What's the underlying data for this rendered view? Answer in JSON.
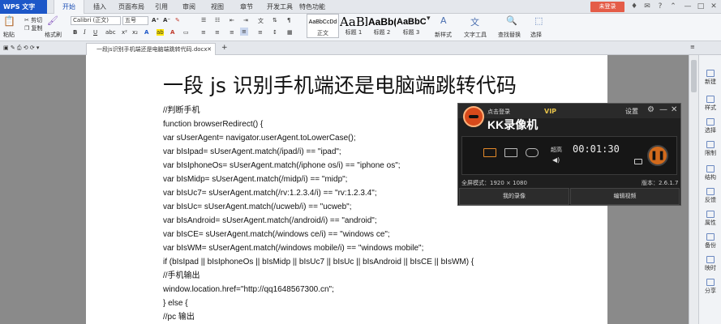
{
  "app": {
    "logo": "WPS 文字",
    "login": "未登录"
  },
  "menu_tabs": [
    "开始",
    "插入",
    "页面布局",
    "引用",
    "审阅",
    "视图",
    "章节",
    "开发工具",
    "特色功能"
  ],
  "ribbon": {
    "paste": "粘贴",
    "cut": "剪切",
    "copy": "复制",
    "format_painter": "格式刷",
    "font_name": "Calibri (正文)",
    "font_size": "五号",
    "styles": [
      {
        "preview": "AaBbCcDd",
        "label": "正文"
      },
      {
        "preview": "AaBl",
        "label": "标题 1"
      },
      {
        "preview": "AaBb(",
        "label": "标题 2"
      },
      {
        "preview": "AaBbC",
        "label": "标题 3"
      }
    ],
    "new_style": "新样式",
    "text_tool": "文字工具",
    "find_replace": "查找替换",
    "select": "选择"
  },
  "doc_tab": "一段js识别手机端还是电脑端跳转代码.docx",
  "sidebar": [
    "新建",
    "样式",
    "选择",
    "限制",
    "结构",
    "反馈",
    "属性",
    "备份",
    "映时",
    "分享"
  ],
  "document": {
    "heading": "一段 js 识别手机端还是电脑端跳转代码",
    "lines": [
      "//判断手机",
      "function browserRedirect() {",
      "var sUserAgent= navigator.userAgent.toLowerCase();",
      "var bIsIpad= sUserAgent.match(/ipad/i) == \"ipad\";",
      "var bIsIphoneOs= sUserAgent.match(/iphone os/i) == \"iphone os\";",
      "var bIsMidp= sUserAgent.match(/midp/i) == \"midp\";",
      "var bIsUc7= sUserAgent.match(/rv:1.2.3.4/i) == \"rv:1.2.3.4\";",
      "var bIsUc= sUserAgent.match(/ucweb/i) == \"ucweb\";",
      "var bIsAndroid= sUserAgent.match(/android/i) == \"android\";",
      "var bIsCE= sUserAgent.match(/windows ce/i) == \"windows ce\";",
      "var bIsWM= sUserAgent.match(/windows mobile/i) == \"windows mobile\";",
      "if (bIsIpad || bIsIphoneOs || bIsMidp || bIsUc7 || bIsUc || bIsAndroid || bIsCE || bIsWM) {",
      "//手机输出",
      "window.location.href=\"http://qq1648567300.cn\";",
      "} else {",
      "//pc 输出"
    ]
  },
  "kk": {
    "click_login": "点击登录",
    "title": "KK录像机",
    "vip": "VIP",
    "settings": "设置",
    "hq": "超高",
    "time": "00:01:30",
    "status": "全屏模式：1920 × 1080",
    "version": "版本：2.6.1.7",
    "my_recordings": "我的录像",
    "edit_video": "编辑视频"
  },
  "colors": {
    "accent": "#1c57c8",
    "login": "#e45c48",
    "record": "#d26a1c"
  }
}
